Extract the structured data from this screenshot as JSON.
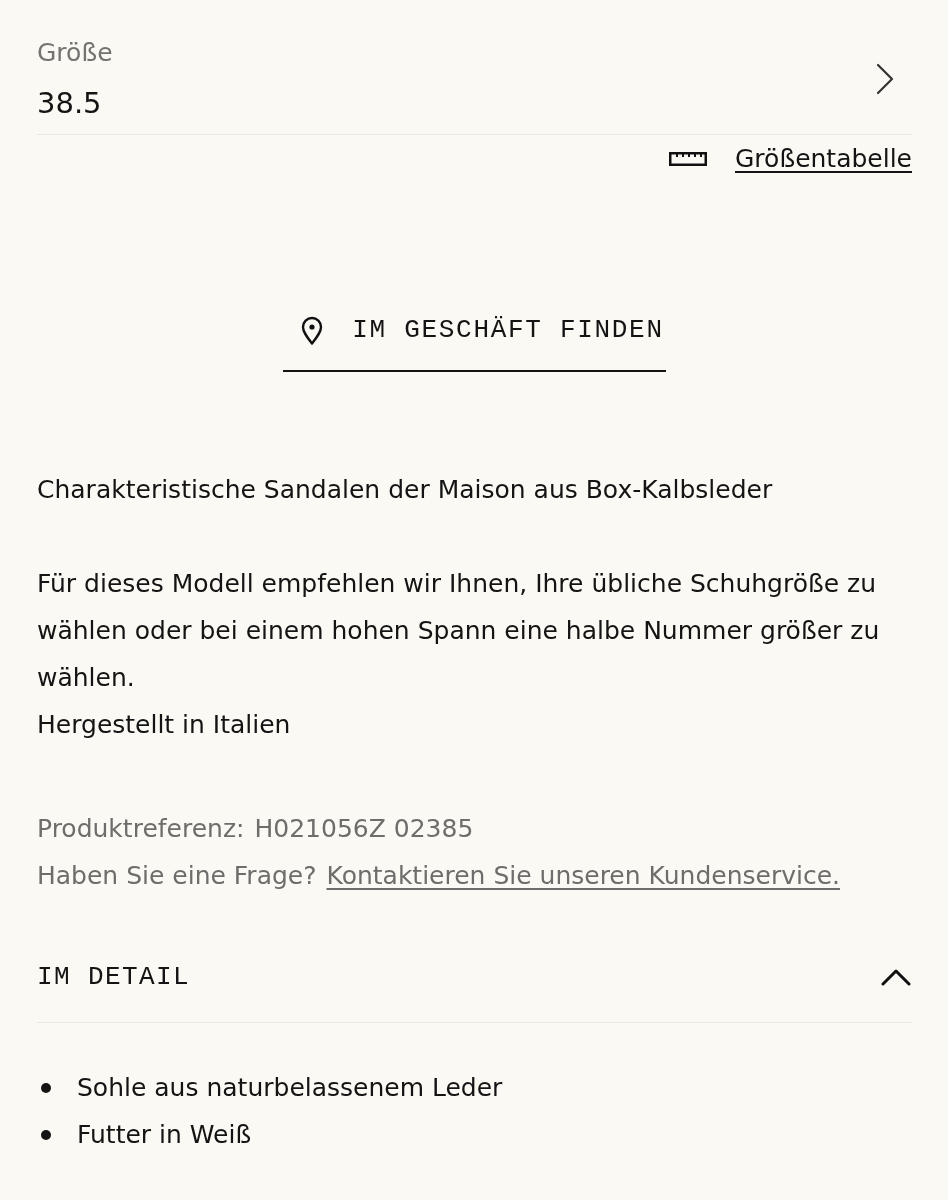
{
  "size_selector": {
    "label": "Größe",
    "value": "38.5"
  },
  "size_chart_link": {
    "label": "Größentabelle"
  },
  "store_button": {
    "label": "IM GESCHÄFT FINDEN"
  },
  "description": {
    "intro": "Charakteristische Sandalen der Maison aus Box-Kalbsleder",
    "notes": [
      "Für dieses Modell empfehlen wir Ihnen, Ihre übliche Schuhgröße zu wählen oder bei einem hohen Spann eine halbe Nummer größer zu wählen.",
      "Hergestellt in Italien"
    ]
  },
  "reference": {
    "label": "Produktreferenz:",
    "value": "H021056Z 02385"
  },
  "question": {
    "text": "Haben Sie eine Frage?",
    "link": "Kontaktieren Sie unseren Kundenservice."
  },
  "details": {
    "title": "IM DETAIL",
    "expanded": true,
    "items": [
      "Sohle aus naturbelassenem Leder",
      "Futter in Weiß"
    ]
  }
}
